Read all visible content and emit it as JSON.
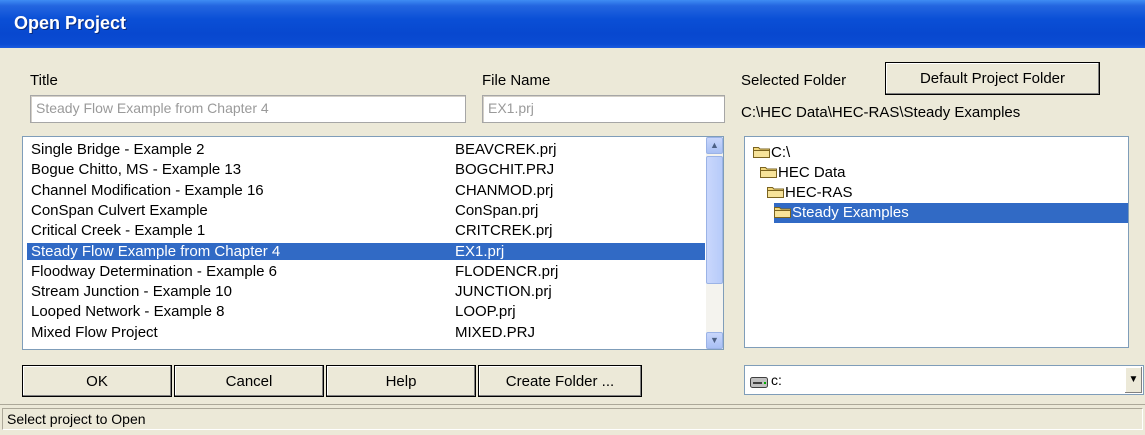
{
  "window": {
    "title": "Open Project"
  },
  "labels": {
    "title": "Title",
    "file_name": "File Name",
    "selected_folder": "Selected Folder"
  },
  "buttons": {
    "default_project_folder": "Default Project Folder",
    "ok": "OK",
    "cancel": "Cancel",
    "help": "Help",
    "create_folder": "Create Folder ..."
  },
  "title_field": {
    "value": "Steady Flow Example from Chapter 4"
  },
  "filename_field": {
    "value": "EX1.prj"
  },
  "selected_folder_path": "C:\\HEC Data\\HEC-RAS\\Steady Examples",
  "projects": [
    {
      "title": "Single Bridge - Example 2",
      "file": "BEAVCREK.prj"
    },
    {
      "title": "Bogue Chitto, MS - Example 13",
      "file": "BOGCHIT.PRJ"
    },
    {
      "title": "Channel Modification - Example 16",
      "file": "CHANMOD.prj"
    },
    {
      "title": "ConSpan Culvert Example",
      "file": "ConSpan.prj"
    },
    {
      "title": "Critical Creek - Example 1",
      "file": "CRITCREK.prj"
    },
    {
      "title": "Steady Flow Example from Chapter 4",
      "file": "EX1.prj",
      "selected": true
    },
    {
      "title": "Floodway Determination - Example 6",
      "file": "FLODENCR.prj"
    },
    {
      "title": "Stream Junction - Example 10",
      "file": "JUNCTION.prj"
    },
    {
      "title": "Looped Network - Example 8",
      "file": "LOOP.prj"
    },
    {
      "title": "Mixed Flow Project",
      "file": "MIXED.PRJ"
    }
  ],
  "folder_tree": [
    {
      "name": "C:\\",
      "depth": 0
    },
    {
      "name": "HEC Data",
      "depth": 1
    },
    {
      "name": "HEC-RAS",
      "depth": 2
    },
    {
      "name": "Steady Examples",
      "depth": 3,
      "selected": true
    }
  ],
  "drive": {
    "value": "c:",
    "icon": "drive-icon"
  },
  "status": {
    "text": "Select project to Open"
  },
  "icons": {
    "folder": "folder-icon",
    "scroll_up": "scroll-up-icon",
    "scroll_down": "scroll-down-icon",
    "dropdown": "chevron-down-icon"
  },
  "colors": {
    "titlebar": "#0a4fd6",
    "selection": "#316ac5",
    "window": "#ece9d8"
  }
}
